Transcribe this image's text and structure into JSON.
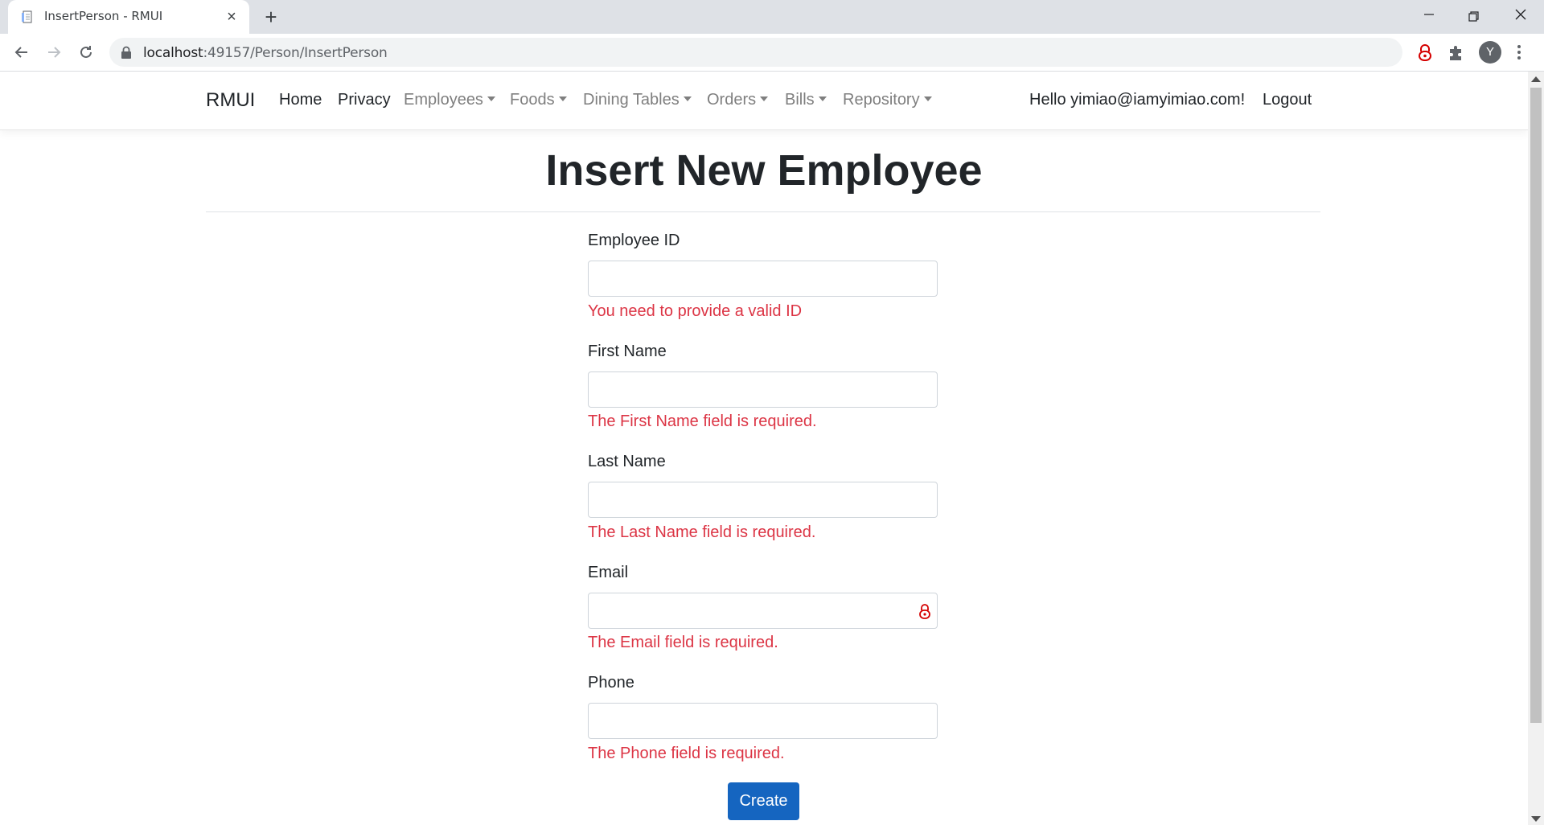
{
  "browser": {
    "tab_title": "InsertPerson - RMUI",
    "url_host": "localhost",
    "url_path": ":49157/Person/InsertPerson",
    "profile_initial": "Y"
  },
  "navbar": {
    "brand": "RMUI",
    "links": [
      {
        "label": "Home"
      },
      {
        "label": "Privacy"
      },
      {
        "label": "Employees"
      },
      {
        "label": "Foods"
      },
      {
        "label": "Dining Tables"
      },
      {
        "label": "Orders"
      },
      {
        "label": "Bills"
      },
      {
        "label": "Repository"
      }
    ],
    "greeting": "Hello yimiao@iamyimiao.com!",
    "logout": "Logout"
  },
  "form": {
    "title": "Insert New Employee",
    "fields": [
      {
        "label": "Employee ID",
        "value": "",
        "error": "You need to provide a valid ID"
      },
      {
        "label": "First Name",
        "value": "",
        "error": "The First Name field is required."
      },
      {
        "label": "Last Name",
        "value": "",
        "error": "The Last Name field is required."
      },
      {
        "label": "Email",
        "value": "",
        "error": "The Email field is required."
      },
      {
        "label": "Phone",
        "value": "",
        "error": "The Phone field is required."
      }
    ],
    "submit_label": "Create"
  },
  "colors": {
    "error": "#dc3545",
    "primary_button": "#1565c0",
    "navbar_text": "#212529",
    "dropdown_text": "#7f7f7f"
  }
}
